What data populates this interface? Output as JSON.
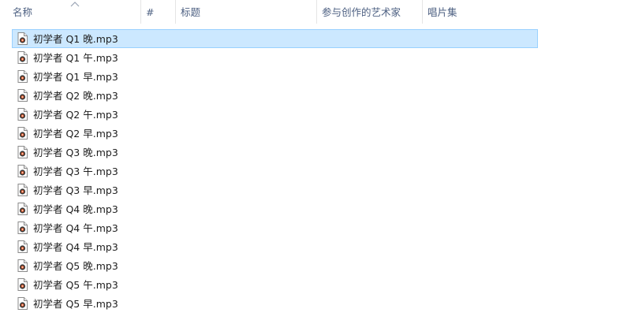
{
  "columns": {
    "name": "名称",
    "number": "#",
    "title": "标题",
    "contributing_artists": "参与创作的艺术家",
    "album": "唱片集"
  },
  "sort_indicator": "chevron-up-icon",
  "file_icon": "audio-file-icon",
  "accent": "#cce8ff",
  "files": [
    {
      "name": "初学者 Q1 晚.mp3",
      "selected": true
    },
    {
      "name": "初学者 Q1 午.mp3",
      "selected": false
    },
    {
      "name": "初学者 Q1 早.mp3",
      "selected": false
    },
    {
      "name": "初学者 Q2 晚.mp3",
      "selected": false
    },
    {
      "name": "初学者 Q2 午.mp3",
      "selected": false
    },
    {
      "name": "初学者 Q2 早.mp3",
      "selected": false
    },
    {
      "name": "初学者 Q3 晚.mp3",
      "selected": false
    },
    {
      "name": "初学者 Q3 午.mp3",
      "selected": false
    },
    {
      "name": "初学者 Q3 早.mp3",
      "selected": false
    },
    {
      "name": "初学者 Q4 晚.mp3",
      "selected": false
    },
    {
      "name": "初学者 Q4 午.mp3",
      "selected": false
    },
    {
      "name": "初学者 Q4 早.mp3",
      "selected": false
    },
    {
      "name": "初学者 Q5 晚.mp3",
      "selected": false
    },
    {
      "name": "初学者 Q5 午.mp3",
      "selected": false
    },
    {
      "name": "初学者 Q5 早.mp3",
      "selected": false
    }
  ]
}
